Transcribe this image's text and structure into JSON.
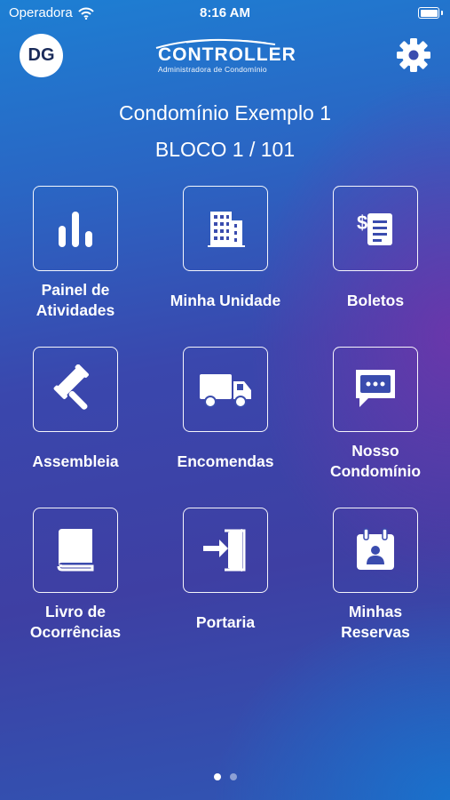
{
  "status_bar": {
    "carrier": "Operadora",
    "time": "8:16 AM"
  },
  "header": {
    "avatar_initials": "DG",
    "logo_title": "CONTROLLER",
    "logo_subtitle": "Administradora de Condomínio"
  },
  "condo_name": "Condomínio Exemplo 1",
  "unit": "BLOCO 1 / 101",
  "menu": [
    {
      "line1": "Painel de",
      "line2": "Atividades",
      "icon": "bar-chart-icon"
    },
    {
      "line1": "Minha Unidade",
      "line2": "",
      "icon": "building-icon"
    },
    {
      "line1": "Boletos",
      "line2": "",
      "icon": "invoice-icon"
    },
    {
      "line1": "Assembleia",
      "line2": "",
      "icon": "gavel-icon"
    },
    {
      "line1": "Encomendas",
      "line2": "",
      "icon": "truck-icon"
    },
    {
      "line1": "Nosso",
      "line2": "Condomínio",
      "icon": "chat-bubble-icon"
    },
    {
      "line1": "Livro de",
      "line2": "Ocorrências",
      "icon": "book-icon"
    },
    {
      "line1": "Portaria",
      "line2": "",
      "icon": "door-enter-icon"
    },
    {
      "line1": "Minhas",
      "line2": "Reservas",
      "icon": "calendar-person-icon"
    }
  ],
  "pager": {
    "pages": 2,
    "current": 1
  }
}
